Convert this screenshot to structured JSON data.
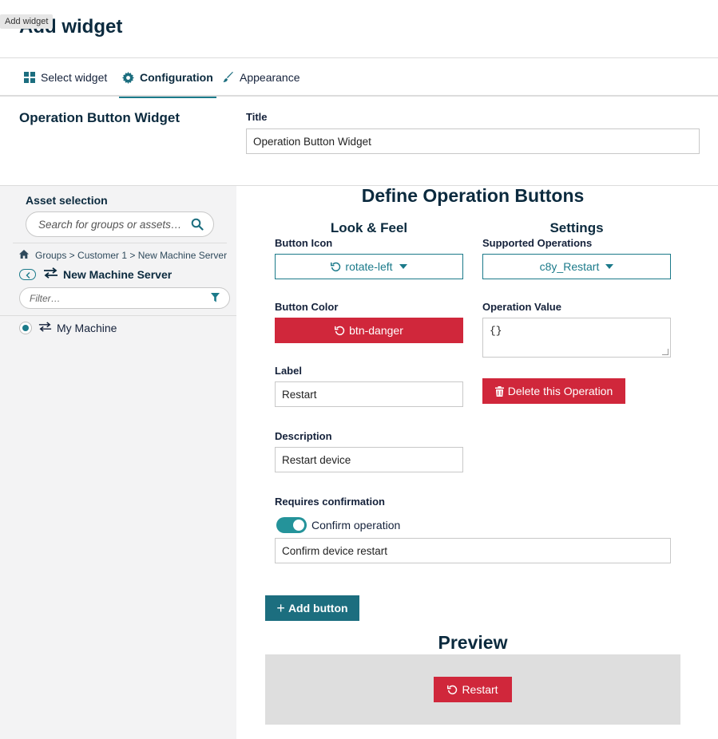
{
  "tooltip": "Add widget",
  "page_title": "Add widget",
  "tabs": [
    {
      "label": "Select widget",
      "icon": "grid-icon"
    },
    {
      "label": "Configuration",
      "icon": "gear-icon"
    },
    {
      "label": "Appearance",
      "icon": "brush-icon"
    }
  ],
  "widget_name": "Operation Button Widget",
  "title_field": {
    "label": "Title",
    "value": "Operation Button Widget"
  },
  "sidebar": {
    "title": "Asset selection",
    "search_placeholder": "Search for groups or assets…",
    "breadcrumb": "Groups > Customer 1 > New Machine Server",
    "current_group": "New Machine Server",
    "filter_placeholder": "Filter…",
    "items": [
      {
        "label": "My Machine",
        "selected": true
      }
    ]
  },
  "define": {
    "title": "Define Operation Buttons",
    "look_feel_title": "Look & Feel",
    "settings_title": "Settings",
    "button_icon_label": "Button Icon",
    "button_icon_value": "rotate-left",
    "supported_ops_label": "Supported Operations",
    "supported_ops_value": "c8y_Restart",
    "button_color_label": "Button Color",
    "button_color_value": "btn-danger",
    "op_value_label": "Operation Value",
    "op_value": "{}",
    "label_label": "Label",
    "label_value": "Restart",
    "delete_label": "Delete this Operation",
    "description_label": "Description",
    "description_value": "Restart device",
    "requires_label": "Requires confirmation",
    "confirm_toggle_label": "Confirm operation",
    "confirm_toggle_on": true,
    "confirm_text": "Confirm device restart",
    "add_button_label": "Add button"
  },
  "preview": {
    "title": "Preview",
    "button_label": "Restart"
  },
  "colors": {
    "accent": "#1b7a8a",
    "danger": "#d0273b",
    "primary": "#1c6e7f",
    "heading": "#0b2a3e"
  }
}
